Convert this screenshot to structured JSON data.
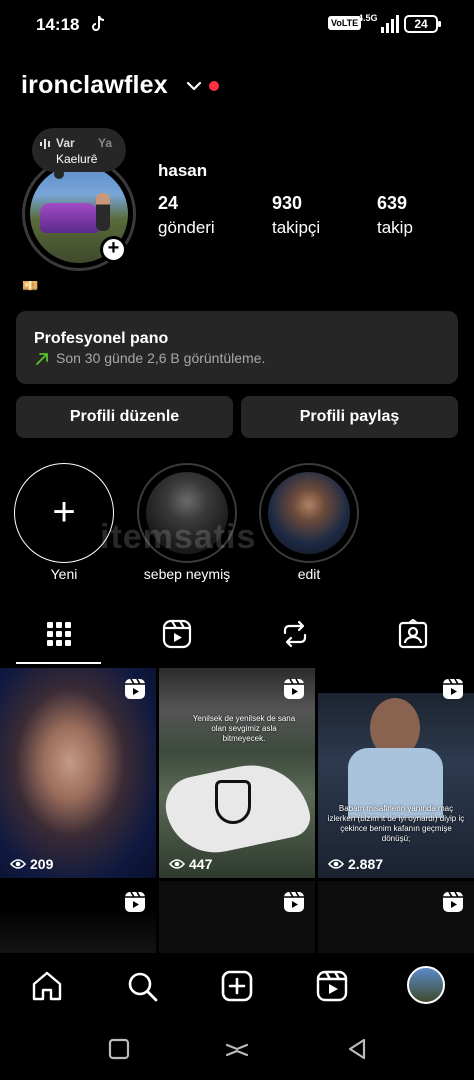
{
  "status_bar": {
    "time": "14:18",
    "volte": "VoLTE",
    "network": "4.5G",
    "battery": "24"
  },
  "header": {
    "username": "ironclawflex"
  },
  "note": {
    "top": "Var",
    "top_dim": "Ya",
    "artist": "Kaelurê"
  },
  "profile": {
    "full_name": "hasan",
    "badge": "💴",
    "stats": [
      {
        "value": "24",
        "label": "gönderi"
      },
      {
        "value": "930",
        "label": "takipçi"
      },
      {
        "value": "639",
        "label": "takip"
      }
    ]
  },
  "dashboard": {
    "title": "Profesyonel pano",
    "subtitle": "Son 30 günde 2,6 B görüntüleme."
  },
  "buttons": {
    "edit": "Profili düzenle",
    "share": "Profili paylaş"
  },
  "highlights": [
    {
      "label": "Yeni"
    },
    {
      "label": "sebep neymiş"
    },
    {
      "label": "edit"
    }
  ],
  "watermark": "itemsatis",
  "posts": [
    {
      "views": "209"
    },
    {
      "views": "447",
      "caption": "Yenilsek de yenilsek de sana olan sevgimiz asla bitmeyecek."
    },
    {
      "views": "2.887",
      "caption": "Babam misafirlerin yanında maç izlerken (bizim it de iyi oynardı) diyip iç çekince benim kafanın geçmişe dönüşü;"
    }
  ],
  "colors": {
    "accent_red": "#ff3040",
    "trend_green": "#58c322",
    "card_bg": "#262626"
  }
}
